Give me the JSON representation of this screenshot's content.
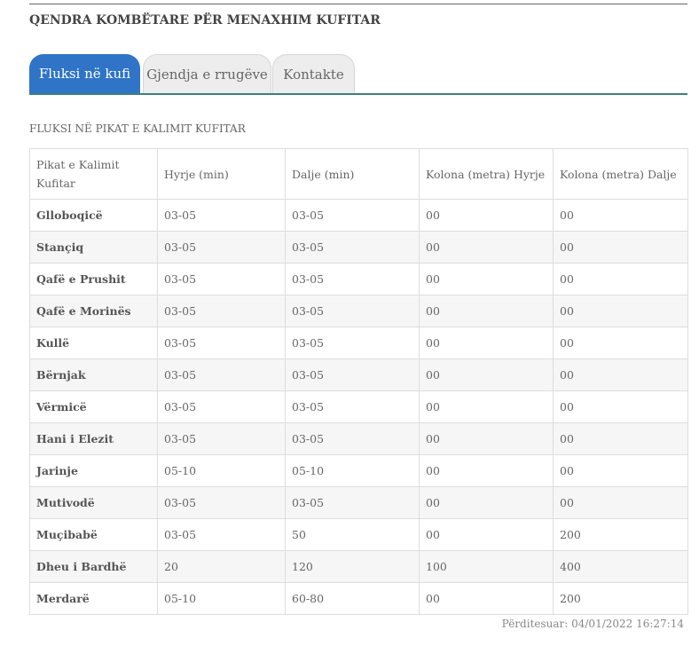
{
  "header": {
    "title": "QENDRA KOMBËTARE PËR MENAXHIM KUFITAR"
  },
  "tabs": [
    {
      "label": "Fluksi në kufi",
      "active": true
    },
    {
      "label": "Gjendja e rrugëve",
      "active": false
    },
    {
      "label": "Kontakte",
      "active": false
    }
  ],
  "colors": {
    "active_tab": "#2f74c6",
    "tab_rule": "#3d7f7f"
  },
  "section": {
    "title": "FLUKSI NË PIKAT E KALIMIT KUFITAR"
  },
  "table": {
    "headers": [
      "Pikat e Kalimit Kufitar",
      "Hyrje (min)",
      "Dalje (min)",
      "Kolona (metra) Hyrje",
      "Kolona (metra) Dalje"
    ],
    "rows": [
      [
        "Glloboqicë",
        "03-05",
        "03-05",
        "00",
        "00"
      ],
      [
        "Stançiq",
        "03-05",
        "03-05",
        "00",
        "00"
      ],
      [
        "Qafë e Prushit",
        "03-05",
        "03-05",
        "00",
        "00"
      ],
      [
        "Qafë e Morinës",
        "03-05",
        "03-05",
        "00",
        "00"
      ],
      [
        "Kullë",
        "03-05",
        "03-05",
        "00",
        "00"
      ],
      [
        "Bërnjak",
        "03-05",
        "03-05",
        "00",
        "00"
      ],
      [
        "Vërmicë",
        "03-05",
        "03-05",
        "00",
        "00"
      ],
      [
        "Hani i Elezit",
        "03-05",
        "03-05",
        "00",
        "00"
      ],
      [
        "Jarinje",
        "05-10",
        "05-10",
        "00",
        "00"
      ],
      [
        "Mutivodë",
        "03-05",
        "03-05",
        "00",
        "00"
      ],
      [
        "Muçibabë",
        "03-05",
        "50",
        "00",
        "200"
      ],
      [
        "Dheu i Bardhë",
        "20",
        "120",
        "100",
        "400"
      ],
      [
        "Merdarë",
        "05-10",
        "60-80",
        "00",
        "200"
      ]
    ]
  },
  "footer": {
    "updated": "Përditesuar: 04/01/2022 16:27:14"
  }
}
